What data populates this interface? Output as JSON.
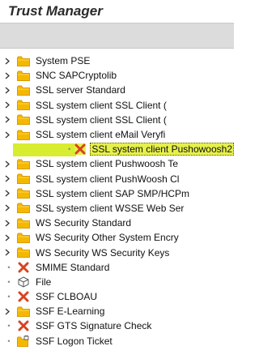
{
  "window": {
    "title": "Trust Manager"
  },
  "tree": {
    "items": [
      {
        "label": "System PSE",
        "icon": "folder-icon",
        "expander": "chevron-right",
        "selected": false
      },
      {
        "label": "SNC SAPCryptolib",
        "icon": "folder-icon",
        "expander": "chevron-right",
        "selected": false
      },
      {
        "label": "SSL server Standard",
        "icon": "folder-icon",
        "expander": "chevron-right",
        "selected": false
      },
      {
        "label": "SSL system client SSL Client (",
        "icon": "folder-icon",
        "expander": "chevron-right",
        "selected": false
      },
      {
        "label": "SSL system client SSL Client (",
        "icon": "folder-icon",
        "expander": "chevron-right",
        "selected": false
      },
      {
        "label": "SSL system client eMail Veryfi",
        "icon": "folder-icon",
        "expander": "chevron-right",
        "selected": false
      },
      {
        "label": "SSL system client Pushowoosh2",
        "icon": "red-x-icon",
        "expander": "dot",
        "selected": true
      },
      {
        "label": "SSL system client Pushwoosh Te",
        "icon": "folder-icon",
        "expander": "chevron-right",
        "selected": false
      },
      {
        "label": "SSL system client PushWoosh Cl",
        "icon": "folder-icon",
        "expander": "chevron-right",
        "selected": false
      },
      {
        "label": "SSL system client SAP SMP/HCPm",
        "icon": "folder-icon",
        "expander": "chevron-right",
        "selected": false
      },
      {
        "label": "SSL system client WSSE Web Ser",
        "icon": "folder-icon",
        "expander": "chevron-right",
        "selected": false
      },
      {
        "label": "WS Security Standard",
        "icon": "folder-icon",
        "expander": "chevron-right",
        "selected": false
      },
      {
        "label": "WS Security Other System Encry",
        "icon": "folder-icon",
        "expander": "chevron-right",
        "selected": false
      },
      {
        "label": "WS Security WS Security Keys",
        "icon": "folder-icon",
        "expander": "chevron-right",
        "selected": false
      },
      {
        "label": "SMIME Standard",
        "icon": "red-x-icon",
        "expander": "dot",
        "selected": false
      },
      {
        "label": "File",
        "icon": "cube-icon",
        "expander": "dot",
        "selected": false
      },
      {
        "label": "SSF CLBOAU",
        "icon": "red-x-icon",
        "expander": "dot",
        "selected": false
      },
      {
        "label": "SSF E-Learning",
        "icon": "folder-icon",
        "expander": "chevron-right",
        "selected": false
      },
      {
        "label": "SSF GTS Signature Check",
        "icon": "red-x-icon",
        "expander": "dot",
        "selected": false
      },
      {
        "label": "SSF Logon Ticket",
        "icon": "folder-lock-icon",
        "expander": "dot",
        "selected": false
      }
    ]
  },
  "colors": {
    "folder": "#f5b800",
    "folder_dark": "#d99a00",
    "red_x": "#d9431e",
    "selection": "#d8ec30",
    "toolbar": "#dcdcdc"
  }
}
